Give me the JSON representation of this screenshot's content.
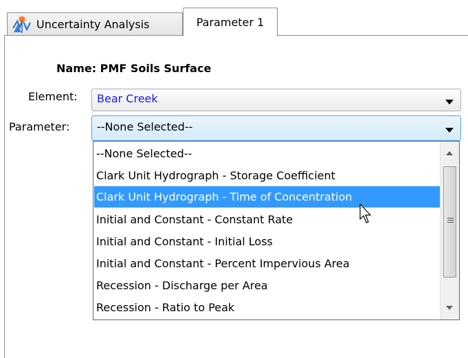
{
  "tabs": [
    {
      "label": "Uncertainty Analysis",
      "icon": "uncertainty-analysis-icon"
    },
    {
      "label": "Parameter 1"
    }
  ],
  "form": {
    "name_label": "Name: PMF Soils Surface",
    "element_label": "Element:",
    "element_value": "Bear Creek",
    "parameter_label": "Parameter:",
    "parameter_value": "--None Selected--"
  },
  "dropdown": {
    "options": [
      "--None Selected--",
      "Clark Unit Hydrograph - Storage Coefficient",
      "Clark Unit Hydrograph - Time of Concentration",
      "Initial and Constant - Constant Rate",
      "Initial and Constant - Initial Loss",
      "Initial and Constant - Percent Impervious Area",
      "Recession - Discharge per Area",
      "Recession - Ratio to Peak"
    ],
    "highlighted_option": "Clark Unit Hydrograph - Time of Concentration"
  },
  "colors": {
    "selection": "#3399ff",
    "element_text": "#1a1adb",
    "focus_border": "#569de5"
  }
}
